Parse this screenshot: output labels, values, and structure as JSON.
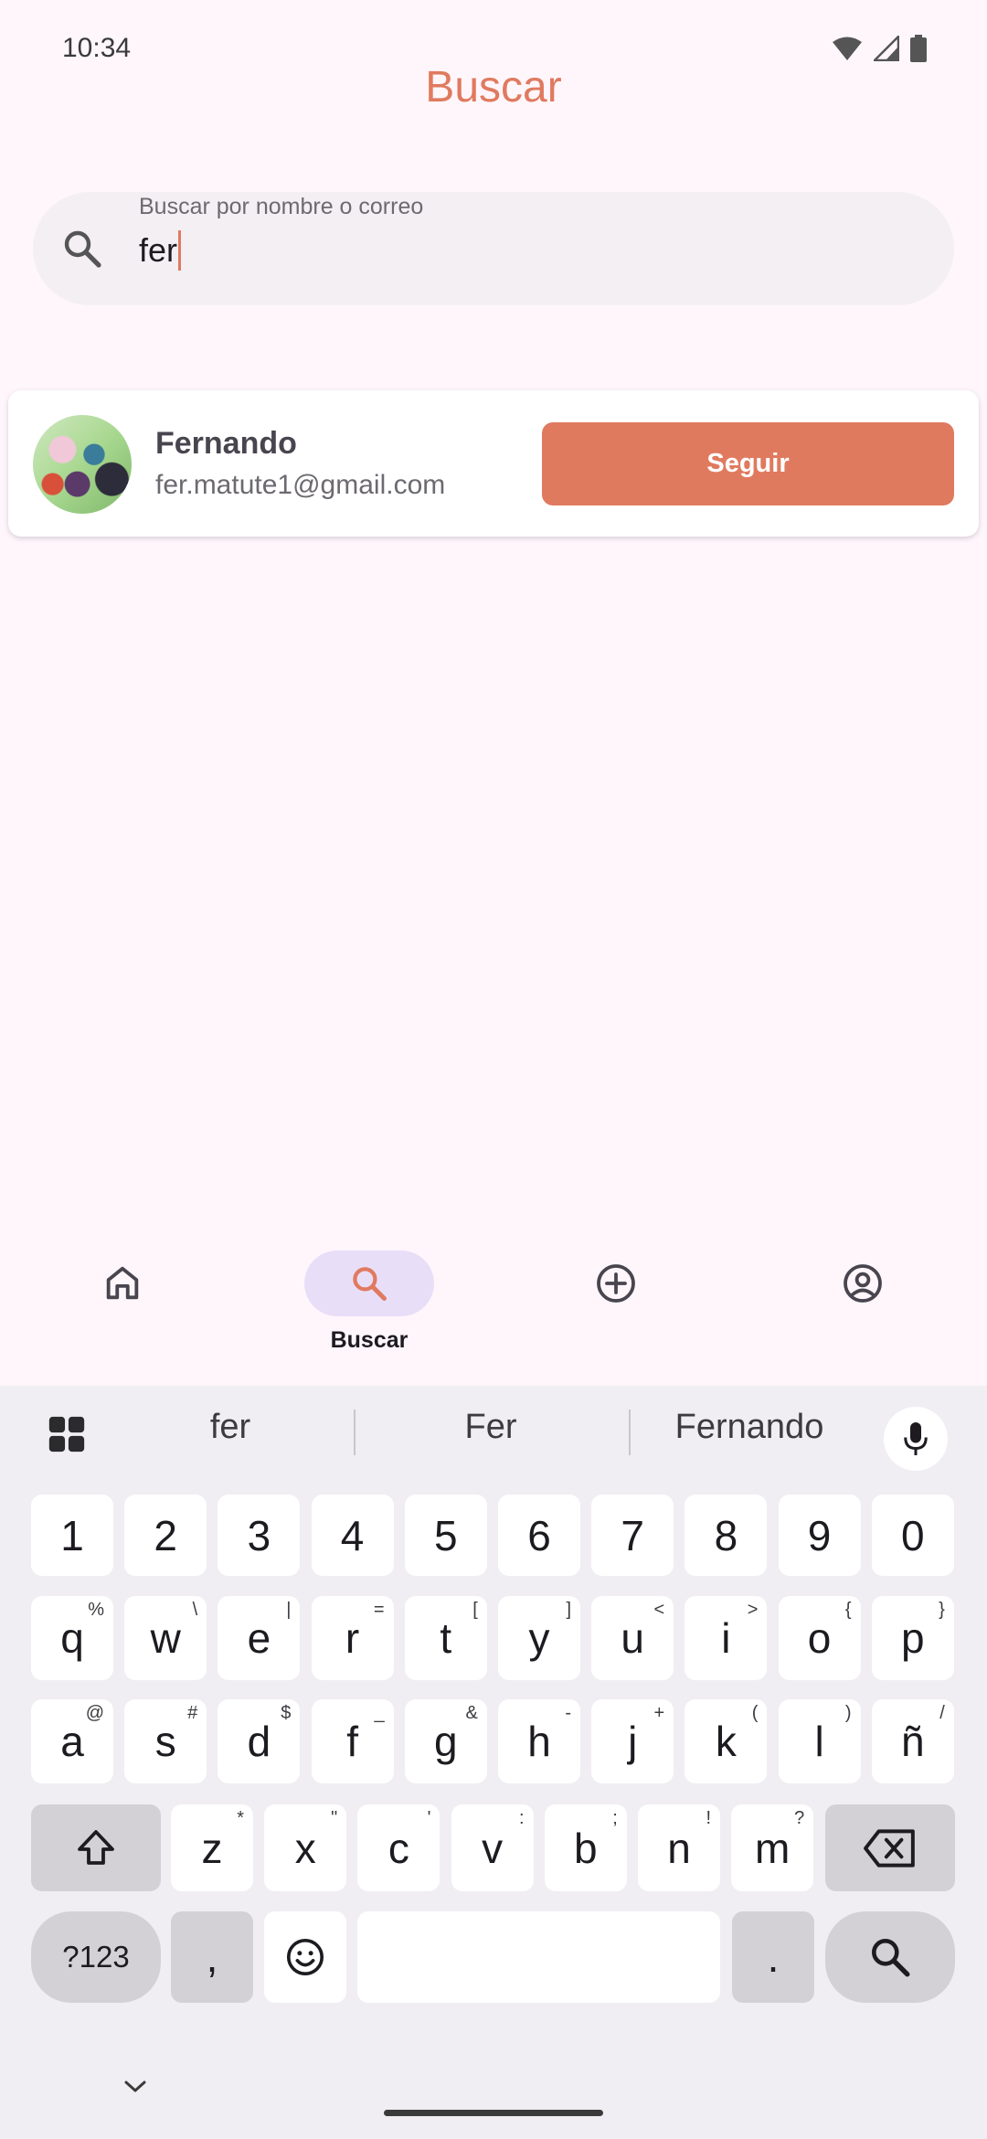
{
  "status": {
    "time": "10:34"
  },
  "header": {
    "title": "Buscar"
  },
  "search": {
    "label": "Buscar por nombre o correo",
    "value": "fer"
  },
  "results": [
    {
      "name": "Fernando",
      "email": "fer.matute1@gmail.com",
      "action": "Seguir"
    }
  ],
  "nav": {
    "active_label": "Buscar"
  },
  "keyboard": {
    "suggestions": [
      "fer",
      "Fer",
      "Fernando"
    ],
    "numbers": [
      "1",
      "2",
      "3",
      "4",
      "5",
      "6",
      "7",
      "8",
      "9",
      "0"
    ],
    "row1": [
      [
        "q",
        "%"
      ],
      [
        "w",
        "\\"
      ],
      [
        "e",
        "|"
      ],
      [
        "r",
        "="
      ],
      [
        "t",
        "["
      ],
      [
        "y",
        "]"
      ],
      [
        "u",
        "<"
      ],
      [
        "i",
        ">"
      ],
      [
        "o",
        "{"
      ],
      [
        "p",
        "}"
      ]
    ],
    "row2": [
      [
        "a",
        "@"
      ],
      [
        "s",
        "#"
      ],
      [
        "d",
        "$"
      ],
      [
        "f",
        "_"
      ],
      [
        "g",
        "&"
      ],
      [
        "h",
        "-"
      ],
      [
        "j",
        "+"
      ],
      [
        "k",
        "("
      ],
      [
        "l",
        ")"
      ],
      [
        "ñ",
        "/"
      ]
    ],
    "row3": [
      [
        "z",
        "*"
      ],
      [
        "x",
        "\""
      ],
      [
        "c",
        "'"
      ],
      [
        "v",
        ":"
      ],
      [
        "b",
        ";"
      ],
      [
        "n",
        "!"
      ],
      [
        "m",
        "?"
      ]
    ],
    "symbols_label": "?123",
    "comma": ",",
    "period": "."
  },
  "colors": {
    "accent": "#e07a5f",
    "background": "#fef6fb",
    "nav_active": "#e8def8"
  }
}
